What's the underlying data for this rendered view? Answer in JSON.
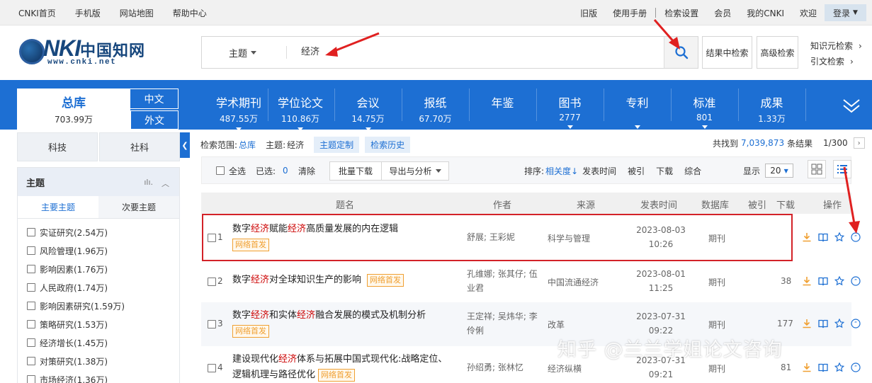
{
  "topbar": {
    "left_links": [
      "CNKI首页",
      "手机版",
      "网站地图",
      "帮助中心"
    ],
    "right_links_a": [
      "旧版",
      "使用手册"
    ],
    "right_links_b": [
      "检索设置",
      "会员",
      "我的CNKI",
      "欢迎"
    ],
    "login": "登录"
  },
  "logo": {
    "brand": "CNKI",
    "name_cn": "中国知网",
    "url": "www.cnki.net"
  },
  "search": {
    "field": "主题",
    "query": "经济",
    "in_results": "结果中检索",
    "advanced": "高级检索",
    "knowledge": "知识元检索",
    "citation": "引文检索"
  },
  "nav": {
    "total": {
      "label": "总库",
      "count": "703.99万"
    },
    "chinese": "中文",
    "foreign": "外文",
    "categories": [
      {
        "label": "学术期刊",
        "count": "487.55万"
      },
      {
        "label": "学位论文",
        "count": "110.86万"
      },
      {
        "label": "会议",
        "count": "14.75万"
      },
      {
        "label": "报纸",
        "count": "67.70万"
      },
      {
        "label": "年鉴",
        "count": ""
      },
      {
        "label": "图书",
        "count": "2777"
      },
      {
        "label": "专利",
        "count": ""
      },
      {
        "label": "标准",
        "count": "801"
      },
      {
        "label": "成果",
        "count": "1.33万"
      }
    ]
  },
  "sidebar": {
    "tabs": [
      "科技",
      "社科"
    ],
    "facet_title": "主题",
    "facet_tabs": [
      "主要主题",
      "次要主题"
    ],
    "items": [
      "实证研究(2.54万)",
      "风险管理(1.96万)",
      "影响因素(1.76万)",
      "人民政府(1.74万)",
      "影响因素研究(1.59万)",
      "策略研究(1.53万)",
      "经济增长(1.45万)",
      "对策研究(1.38万)",
      "市场经济(1.36万)"
    ]
  },
  "results_info": {
    "scope_label": "检索范围:",
    "scope_value": "总库",
    "topic_label": "主题:",
    "topic_value": "经济",
    "customize": "主题定制",
    "history": "检索历史",
    "found_prefix": "共找到",
    "found_count": "7,039,873",
    "found_suffix": "条结果",
    "page": "1/300"
  },
  "toolbar": {
    "select_all": "全选",
    "selected_label": "已选:",
    "selected_count": "0",
    "clear": "清除",
    "batch_download": "批量下载",
    "export": "导出与分析",
    "sort_label": "排序:",
    "sort_relevance": "相关度",
    "sort_date": "发表时间",
    "sort_cited": "被引",
    "sort_download": "下载",
    "sort_composite": "综合",
    "show_label": "显示",
    "show_count": "20"
  },
  "table": {
    "headers": [
      "题名",
      "作者",
      "来源",
      "发表时间",
      "数据库",
      "被引",
      "下载",
      "操作"
    ],
    "badge": "网络首发",
    "rows": [
      {
        "index": "1",
        "title_parts": [
          "数字",
          "经济",
          "赋能",
          "经济",
          "高质量发展的内在逻辑"
        ],
        "authors": "舒展; 王彩妮",
        "source": "科学与管理",
        "date": "2023-08-03",
        "time": "10:26",
        "db": "期刊",
        "cited": ""
      },
      {
        "index": "2",
        "title_parts": [
          "数字",
          "经济",
          "对全球知识生产的影响"
        ],
        "authors": "孔维娜; 张其仔; 伍业君",
        "source": "中国流通经济",
        "date": "2023-08-01",
        "time": "11:25",
        "db": "期刊",
        "cited": "38"
      },
      {
        "index": "3",
        "title_parts": [
          "数字",
          "经济",
          "和实体",
          "经济",
          "融合发展的模式及机制分析"
        ],
        "authors": "王定祥; 吴炜华; 李伶俐",
        "source": "改革",
        "date": "2023-07-31",
        "time": "09:22",
        "db": "期刊",
        "cited": "177"
      },
      {
        "index": "4",
        "title_parts": [
          "建设现代化",
          "经济",
          "体系与拓展中国式现代化:战略定位、逻辑机理与路径优化"
        ],
        "authors": "孙绍勇; 张林忆",
        "source": "经济纵横",
        "date": "2023-07-31",
        "time": "09:21",
        "db": "期刊",
        "cited": "81"
      }
    ]
  },
  "watermark": "知乎 @兰兰学姐论文咨询",
  "colors": {
    "brand_blue": "#1d6fd3",
    "highlight_red": "#cc0000",
    "badge_orange": "#f0a032",
    "annotation_red": "#d32228"
  }
}
